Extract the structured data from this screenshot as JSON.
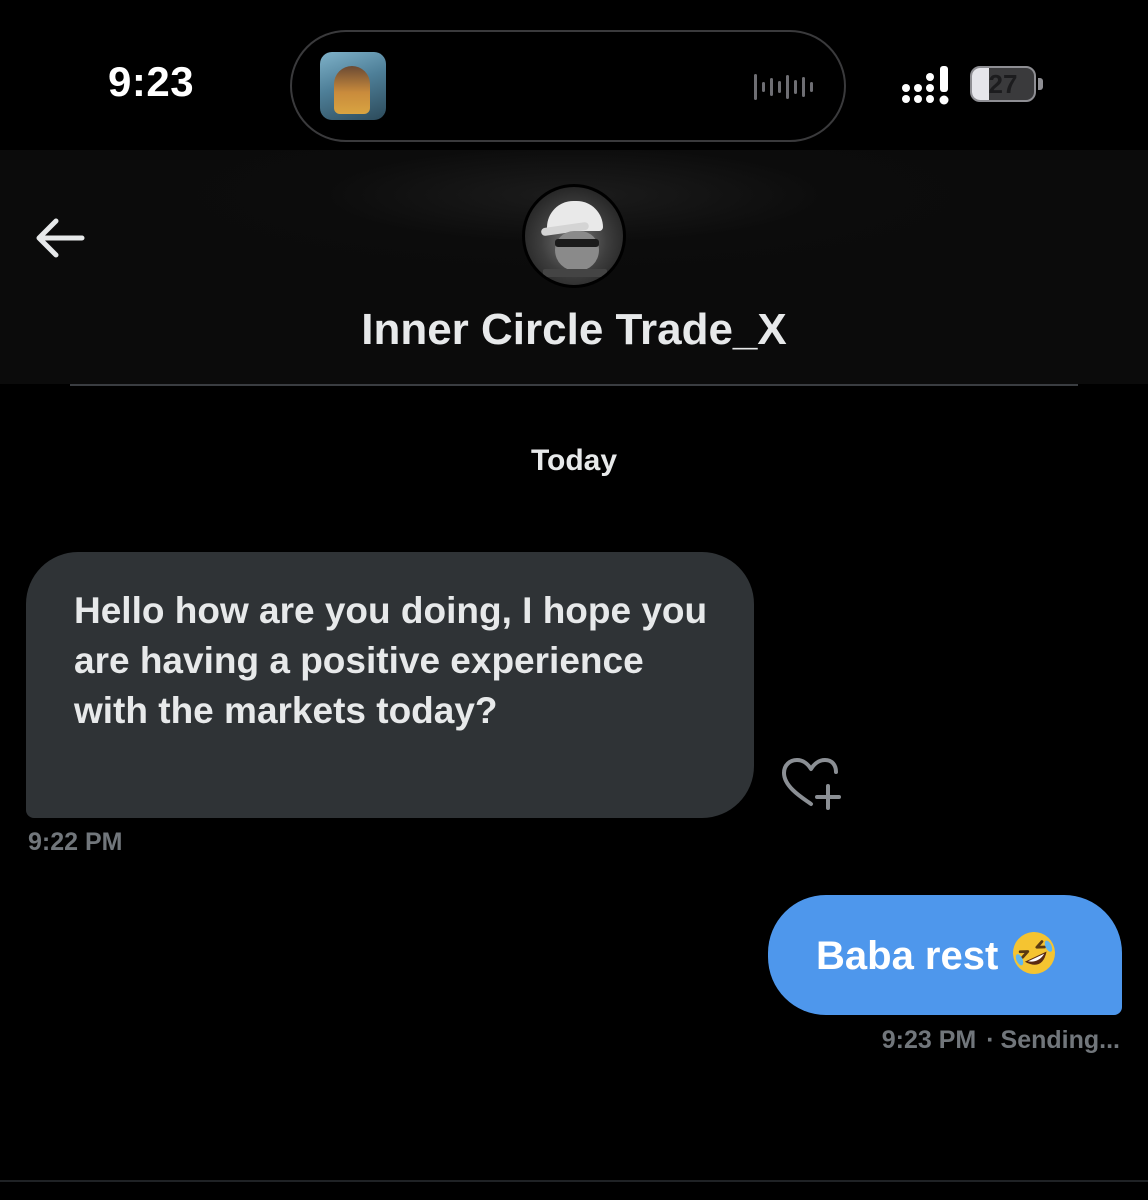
{
  "status_bar": {
    "time": "9:23",
    "battery_level": "27",
    "battery_fraction": 0.27
  },
  "dynamic_island": {
    "icons": [
      "now-playing-thumbnail",
      "audio-waveform-icon"
    ]
  },
  "header": {
    "back_icon": "back-arrow-icon",
    "contact_name": "Inner Circle Trade_X"
  },
  "conversation": {
    "date_label": "Today",
    "messages": [
      {
        "direction": "received",
        "text": "Hello how are you doing, I hope you are having a positive experience with the markets today?",
        "time": "9:22 PM"
      },
      {
        "direction": "sent",
        "text": "Baba rest",
        "emoji": "rolling-on-floor-laughing-emoji",
        "time": "9:23 PM",
        "status_separator": "·",
        "status": "Sending..."
      }
    ],
    "react_icon": "heart-plus-icon"
  },
  "colors": {
    "background": "#000000",
    "received_bubble": "#2f3336",
    "sent_bubble": "#4e97ec",
    "secondary_text": "#71767b",
    "primary_text": "#e7e9ea"
  }
}
